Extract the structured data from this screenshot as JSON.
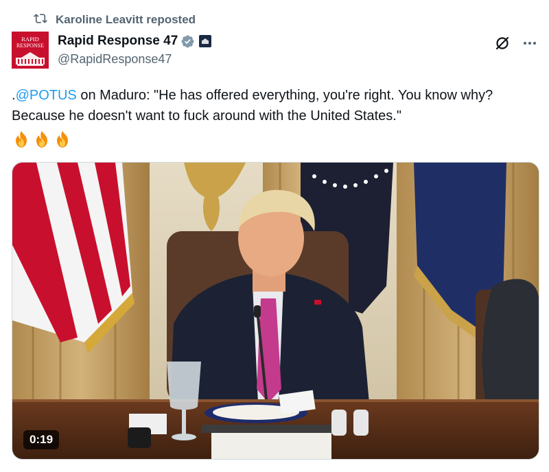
{
  "repost": {
    "label": "Karoline Leavitt reposted",
    "icon": "repost-icon"
  },
  "author": {
    "avatar_text_line1": "RAPID",
    "avatar_text_line2": "RESPONSE",
    "display_name": "Rapid Response 47",
    "handle": "@RapidResponse47",
    "verified_color": "#829aab",
    "affiliate_badge_text": "WHITE HOUSE"
  },
  "actions": {
    "grok_icon": "grok-icon",
    "more_icon": "more-icon"
  },
  "tweet": {
    "prefix": ".",
    "mention": "@POTUS",
    "body": " on Maduro: \"He has offered everything, you're right. You know why? Because he doesn't want to fuck around with the United States.\"",
    "emoji_count": 3,
    "emoji": "fire-emoji"
  },
  "media": {
    "type": "video",
    "duration": "0:19"
  },
  "colors": {
    "link": "#1d9bf0",
    "secondary_text": "#536471",
    "primary_text": "#0f1419",
    "brand_red": "#c8102e"
  }
}
